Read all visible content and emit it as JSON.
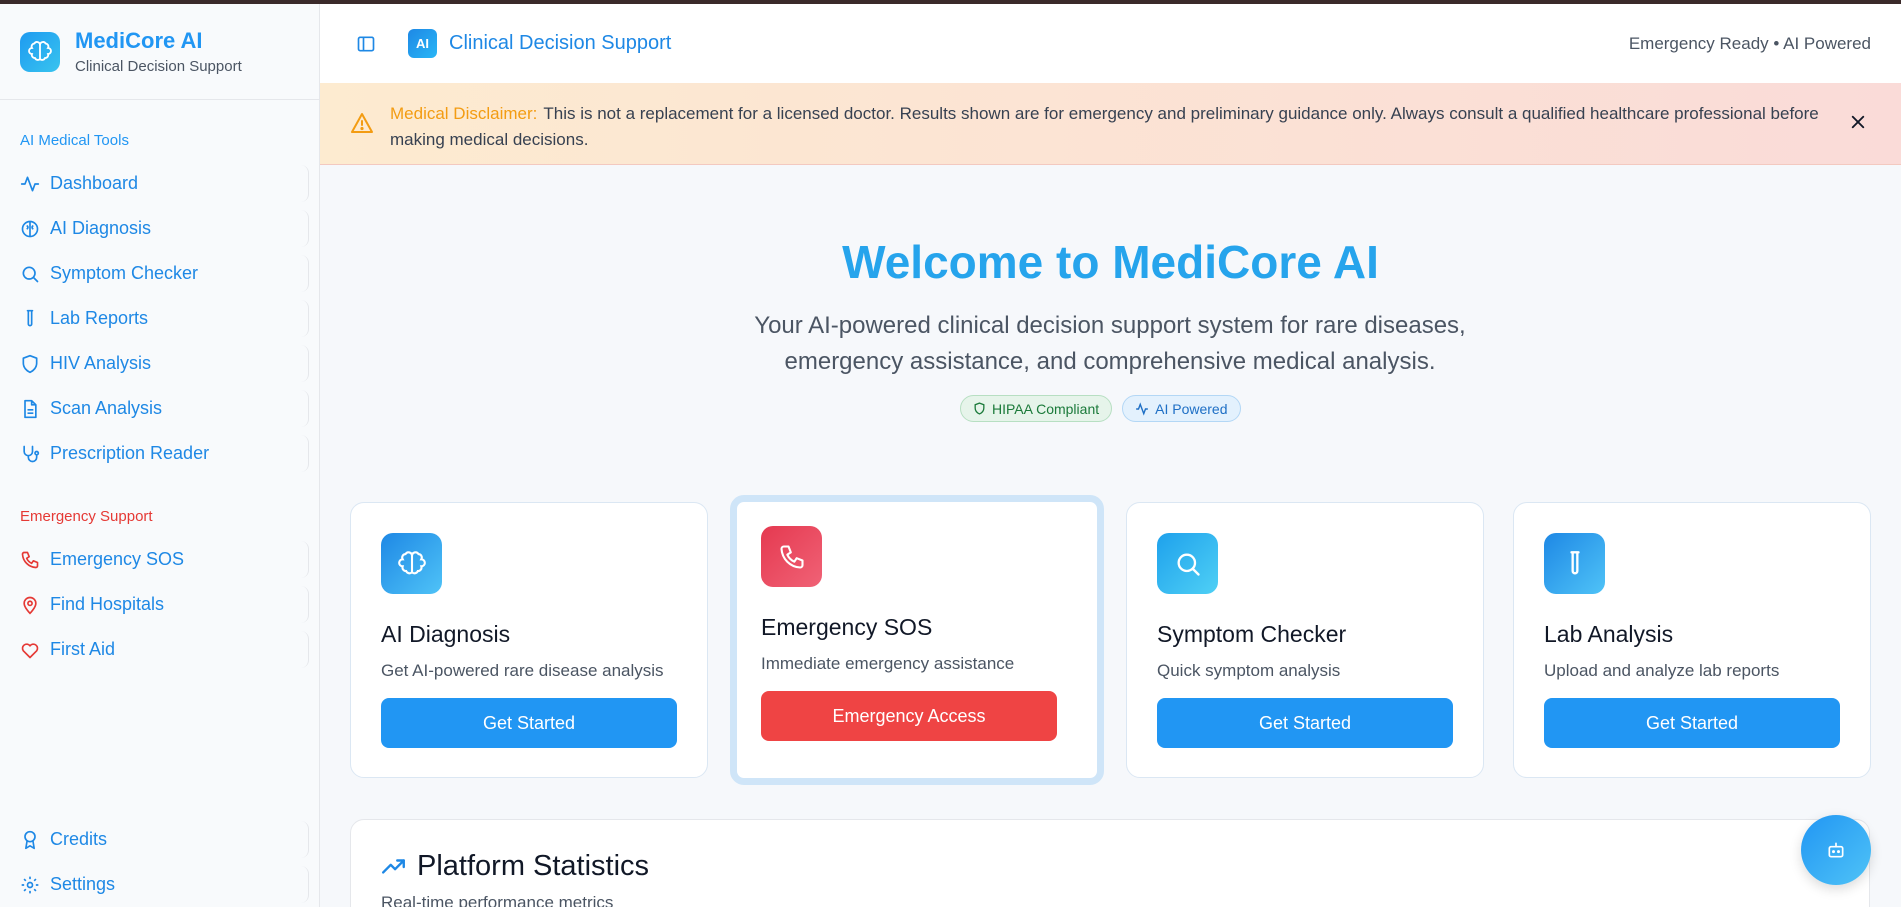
{
  "brand": {
    "name": "MediCore AI",
    "subtitle": "Clinical Decision Support"
  },
  "sidebar": {
    "tools_title": "AI Medical Tools",
    "tools": [
      {
        "label": "Dashboard",
        "icon": "activity-icon"
      },
      {
        "label": "AI Diagnosis",
        "icon": "brain-icon"
      },
      {
        "label": "Symptom Checker",
        "icon": "search-icon"
      },
      {
        "label": "Lab Reports",
        "icon": "test-tube-icon"
      },
      {
        "label": "HIV Analysis",
        "icon": "shield-icon"
      },
      {
        "label": "Scan Analysis",
        "icon": "document-icon"
      },
      {
        "label": "Prescription Reader",
        "icon": "stethoscope-icon"
      }
    ],
    "emergency_title": "Emergency Support",
    "emergency": [
      {
        "label": "Emergency SOS",
        "icon": "phone-icon"
      },
      {
        "label": "Find Hospitals",
        "icon": "map-pin-icon"
      },
      {
        "label": "First Aid",
        "icon": "heart-icon"
      }
    ],
    "bottom": [
      {
        "label": "Credits",
        "icon": "award-icon"
      },
      {
        "label": "Settings",
        "icon": "gear-icon"
      }
    ]
  },
  "header": {
    "badge": "AI",
    "title": "Clinical Decision Support",
    "status": "Emergency Ready • AI Powered"
  },
  "disclaimer": {
    "label": "Medical Disclaimer:",
    "text": "This is not a replacement for a licensed doctor. Results shown are for emergency and preliminary guidance only. Always consult a qualified healthcare professional before making medical decisions."
  },
  "hero": {
    "title": "Welcome to MediCore AI",
    "subtitle": "Your AI-powered clinical decision support system for rare diseases, emergency assistance, and comprehensive medical analysis.",
    "chips": [
      "HIPAA Compliant",
      "AI Powered"
    ]
  },
  "cards": [
    {
      "title": "AI Diagnosis",
      "desc": "Get AI-powered rare disease analysis",
      "button": "Get Started",
      "icon": "brain-icon",
      "color": "#29a3ec"
    },
    {
      "title": "Emergency SOS",
      "desc": "Immediate emergency assistance",
      "button": "Emergency Access",
      "icon": "phone-icon",
      "color": "#ef4560"
    },
    {
      "title": "Symptom Checker",
      "desc": "Quick symptom analysis",
      "button": "Get Started",
      "icon": "search-icon",
      "color": "#2ab0ee"
    },
    {
      "title": "Lab Analysis",
      "desc": "Upload and analyze lab reports",
      "button": "Get Started",
      "icon": "test-tube-icon",
      "color": "#229ff0"
    }
  ],
  "stats": {
    "title": "Platform Statistics",
    "subtitle": "Real-time performance metrics"
  },
  "colors": {
    "primary": "#2196f3",
    "danger": "#ef4444",
    "warning": "#f39c12"
  }
}
